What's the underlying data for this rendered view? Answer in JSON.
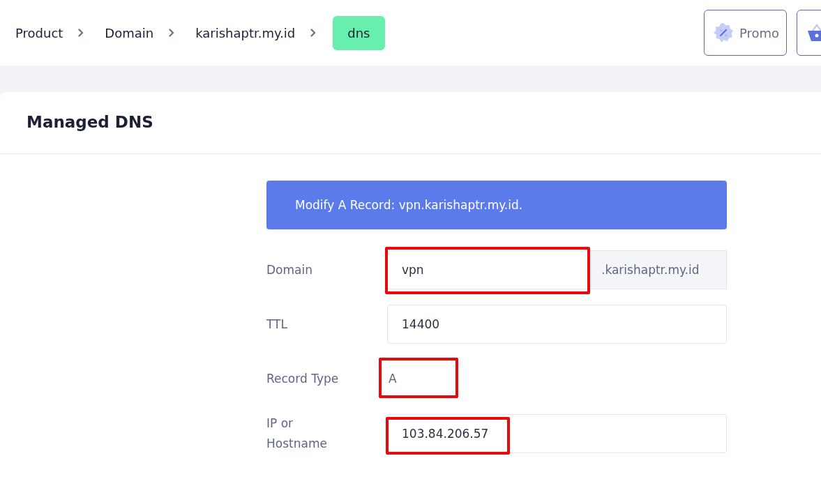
{
  "breadcrumbs": [
    {
      "label": "Product",
      "selected": false
    },
    {
      "label": "Domain",
      "selected": false
    },
    {
      "label": "karishaptr.my.id",
      "selected": false
    },
    {
      "label": "dns",
      "selected": true
    }
  ],
  "header_buttons": [
    {
      "kind": "promo",
      "label": "Promo"
    },
    {
      "kind": "cart"
    }
  ],
  "card": {
    "title": "Managed DNS"
  },
  "alert": "Modify A Record: vpn.karishaptr.my.id.",
  "fields": [
    {
      "kind": "input-addon",
      "label": "Domain",
      "value": "vpn",
      "addon": ".karishaptr.my.id",
      "highlighted": true
    },
    {
      "kind": "input",
      "label": "TTL",
      "value": "14400",
      "highlighted": false
    },
    {
      "kind": "text",
      "label": "Record Type",
      "value": "A",
      "highlighted": true
    },
    {
      "kind": "input",
      "label": "IP or Hostname",
      "value": "103.84.206.57",
      "highlighted": true
    }
  ]
}
